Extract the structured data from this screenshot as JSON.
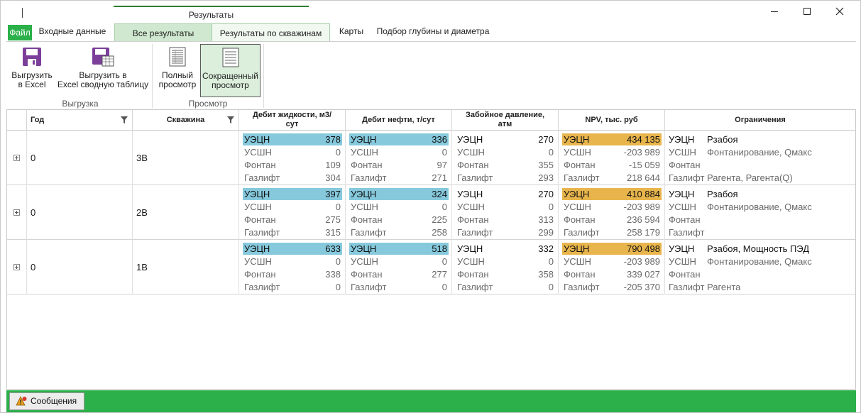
{
  "app": {
    "context_group_label": "Результаты"
  },
  "tabs": {
    "file": "Файл",
    "input_data": "Входные данные",
    "all_results": "Все результаты",
    "results_by_wells": "Результаты по скважинам",
    "maps": "Карты",
    "depth_diameter": "Подбор глубины и диаметра"
  },
  "ribbon": {
    "export_excel": "Выгрузить\nв Excel",
    "export_pivot": "Выгрузить в\nExcel сводную таблицу",
    "export_group": "Выгрузка",
    "full_view": "Полный\nпросмотр",
    "short_view": "Сокращенный\nпросмотр",
    "view_group": "Просмотр"
  },
  "grid": {
    "headers": {
      "year": "Год",
      "well": "Скважина",
      "liquid": "Дебит жидкости, м3/\nсут",
      "oil": "Дебит нефти, т/сут",
      "pressure": "Забойное давление,\nатм",
      "npv": "NPV, тыс. руб",
      "limits": "Ограничения"
    },
    "rows": [
      {
        "year": "0",
        "well": "3В",
        "liquid": [
          [
            "УЭЦН",
            "378"
          ],
          [
            "УСШН",
            "0"
          ],
          [
            "Фонтан",
            "109"
          ],
          [
            "Газлифт",
            "304"
          ]
        ],
        "oil": [
          [
            "УЭЦН",
            "336"
          ],
          [
            "УСШН",
            "0"
          ],
          [
            "Фонтан",
            "97"
          ],
          [
            "Газлифт",
            "271"
          ]
        ],
        "pressure": [
          [
            "УЭЦН",
            "270"
          ],
          [
            "УСШН",
            "0"
          ],
          [
            "Фонтан",
            "355"
          ],
          [
            "Газлифт",
            "293"
          ]
        ],
        "npv": [
          [
            "УЭЦН",
            "434 135"
          ],
          [
            "УСШН",
            "-203 989"
          ],
          [
            "Фонтан",
            "-15 059"
          ],
          [
            "Газлифт",
            "218 644"
          ]
        ],
        "limits": [
          [
            "УЭЦН",
            "Рзабоя"
          ],
          [
            "УСШН",
            "Фонтанирование, Qмакс"
          ],
          [
            "Фонтан",
            ""
          ],
          [
            "Газлифт",
            "Рагента, Рагента(Q)"
          ]
        ]
      },
      {
        "year": "0",
        "well": "2В",
        "liquid": [
          [
            "УЭЦН",
            "397"
          ],
          [
            "УСШН",
            "0"
          ],
          [
            "Фонтан",
            "275"
          ],
          [
            "Газлифт",
            "315"
          ]
        ],
        "oil": [
          [
            "УЭЦН",
            "324"
          ],
          [
            "УСШН",
            "0"
          ],
          [
            "Фонтан",
            "225"
          ],
          [
            "Газлифт",
            "258"
          ]
        ],
        "pressure": [
          [
            "УЭЦН",
            "270"
          ],
          [
            "УСШН",
            "0"
          ],
          [
            "Фонтан",
            "313"
          ],
          [
            "Газлифт",
            "299"
          ]
        ],
        "npv": [
          [
            "УЭЦН",
            "410 884"
          ],
          [
            "УСШН",
            "-203 989"
          ],
          [
            "Фонтан",
            "236 594"
          ],
          [
            "Газлифт",
            "258 179"
          ]
        ],
        "limits": [
          [
            "УЭЦН",
            "Рзабоя"
          ],
          [
            "УСШН",
            "Фонтанирование, Qмакс"
          ],
          [
            "Фонтан",
            ""
          ],
          [
            "Газлифт",
            ""
          ]
        ]
      },
      {
        "year": "0",
        "well": "1В",
        "liquid": [
          [
            "УЭЦН",
            "633"
          ],
          [
            "УСШН",
            "0"
          ],
          [
            "Фонтан",
            "338"
          ],
          [
            "Газлифт",
            "0"
          ]
        ],
        "oil": [
          [
            "УЭЦН",
            "518"
          ],
          [
            "УСШН",
            "0"
          ],
          [
            "Фонтан",
            "277"
          ],
          [
            "Газлифт",
            "0"
          ]
        ],
        "pressure": [
          [
            "УЭЦН",
            "332"
          ],
          [
            "УСШН",
            "0"
          ],
          [
            "Фонтан",
            "358"
          ],
          [
            "Газлифт",
            "0"
          ]
        ],
        "npv": [
          [
            "УЭЦН",
            "790 498"
          ],
          [
            "УСШН",
            "-203 989"
          ],
          [
            "Фонтан",
            "339 027"
          ],
          [
            "Газлифт",
            "-205 370"
          ]
        ],
        "limits": [
          [
            "УЭЦН",
            "Рзабоя, Мощность ПЭД"
          ],
          [
            "УСШН",
            "Фонтанирование, Qмакс"
          ],
          [
            "Фонтан",
            ""
          ],
          [
            "Газлифт",
            "Рагента"
          ]
        ]
      }
    ]
  },
  "status": {
    "messages": "Сообщения"
  },
  "icons": {
    "export_excel": "floppy-icon",
    "export_pivot": "floppy-table-icon",
    "full_view": "full-view-icon",
    "short_view": "short-view-icon",
    "filter": "filter-icon",
    "messages": "warning-icon"
  },
  "colors": {
    "accent_green": "#2bb04a",
    "selected_tab": "#cfe8cf",
    "highlight_blue": "#86c9dd",
    "highlight_orange": "#e8b54c",
    "floppy_purple": "#7b3f9a"
  }
}
